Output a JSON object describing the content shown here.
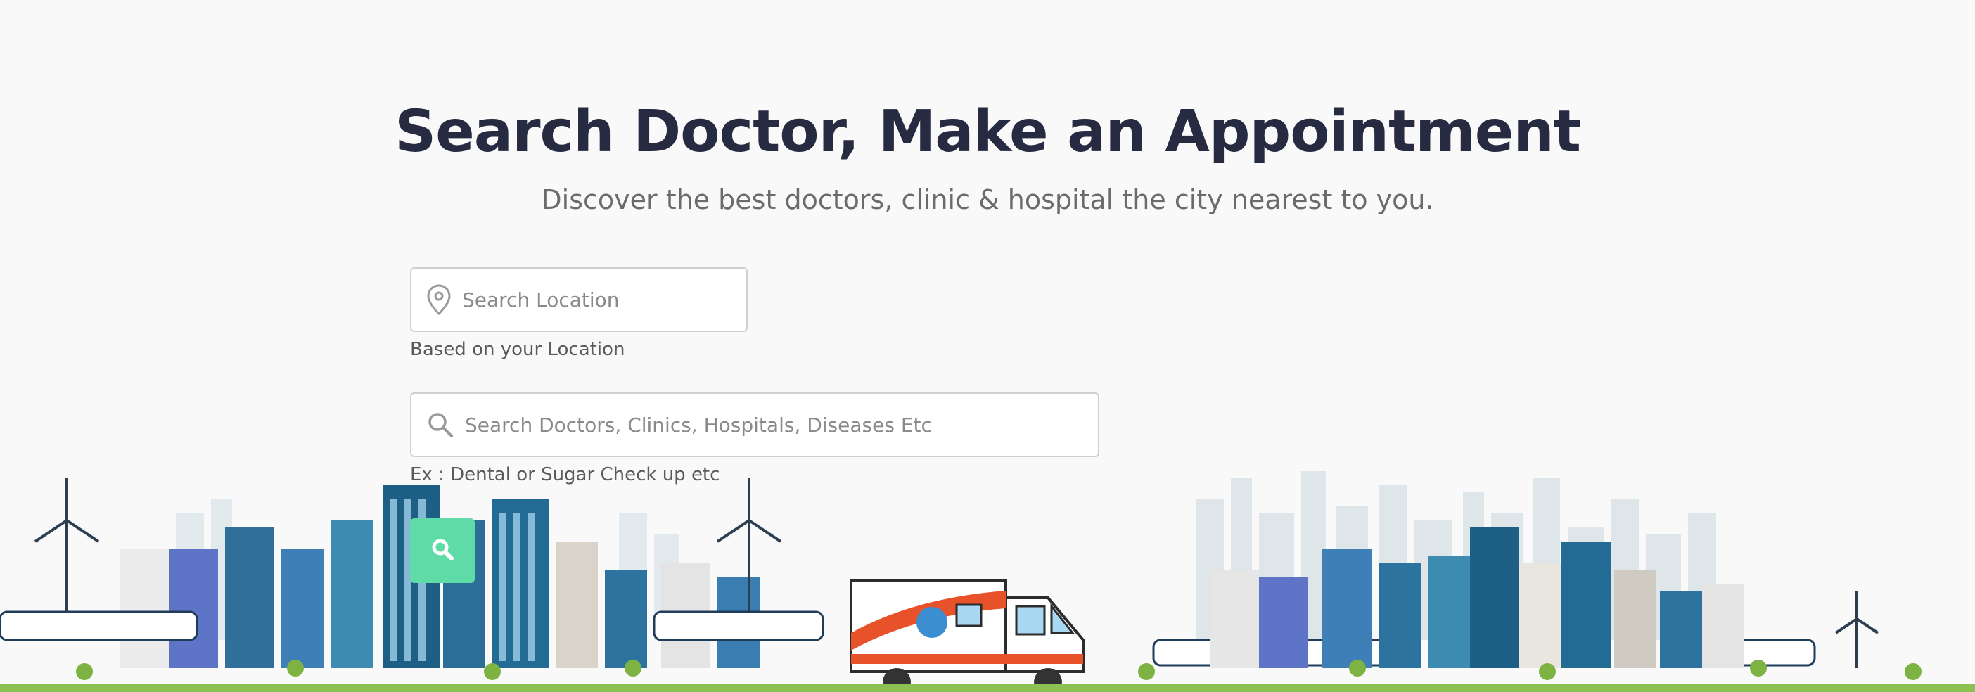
{
  "hero": {
    "title": "Search Doctor, Make an Appointment",
    "subtitle": "Discover the best doctors, clinic & hospital the city nearest to you."
  },
  "location_search": {
    "placeholder": "Search Location",
    "icon": "map-pin-icon",
    "hint": "Based on your Location"
  },
  "keyword_search": {
    "placeholder": "Search Doctors, Clinics, Hospitals, Diseases Etc",
    "icon": "search-icon",
    "hint": "Ex : Dental or Sugar Check up etc"
  },
  "search_button": {
    "icon": "search-icon",
    "color": "#5fdba7"
  },
  "colors": {
    "title": "#272b41",
    "subtitle": "#6b6b6b",
    "background": "#f9f9f9",
    "accent": "#5fdba7"
  }
}
